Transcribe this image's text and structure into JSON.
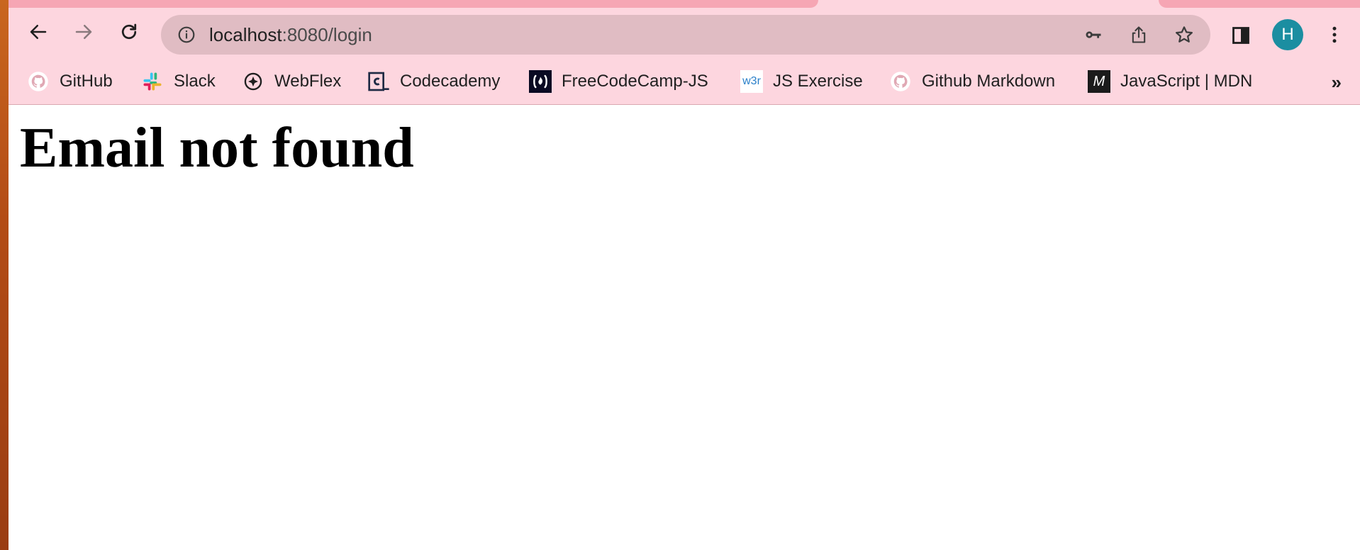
{
  "browser": {
    "address_bar": {
      "host": "localhost",
      "rest": ":8080/login"
    },
    "profile_initial": "H",
    "icons": [
      "back-arrow",
      "forward-arrow",
      "reload",
      "info",
      "key",
      "share",
      "star",
      "side-panel",
      "more-vert"
    ]
  },
  "bookmarks": [
    {
      "label": "GitHub",
      "icon": "github-icon"
    },
    {
      "label": "Slack",
      "icon": "slack-icon"
    },
    {
      "label": "WebFlex",
      "icon": "webflex-icon"
    },
    {
      "label": "Codecademy",
      "icon": "codecademy-icon"
    },
    {
      "label": "FreeCodeCamp-JS",
      "icon": "freecodecamp-icon"
    },
    {
      "label": "JS Exercise",
      "icon": "w3r-icon",
      "icon_text": "w3r"
    },
    {
      "label": "Github Markdown",
      "icon": "github-icon"
    },
    {
      "label": "JavaScript | MDN",
      "icon": "mdn-icon",
      "icon_text": "M"
    }
  ],
  "bookmarks_overflow": "»",
  "page": {
    "heading": "Email not found"
  },
  "colors": {
    "toolbar": "#fdd6df",
    "omnibox": "#e0bcc3",
    "avatar": "#1b8ea1"
  }
}
